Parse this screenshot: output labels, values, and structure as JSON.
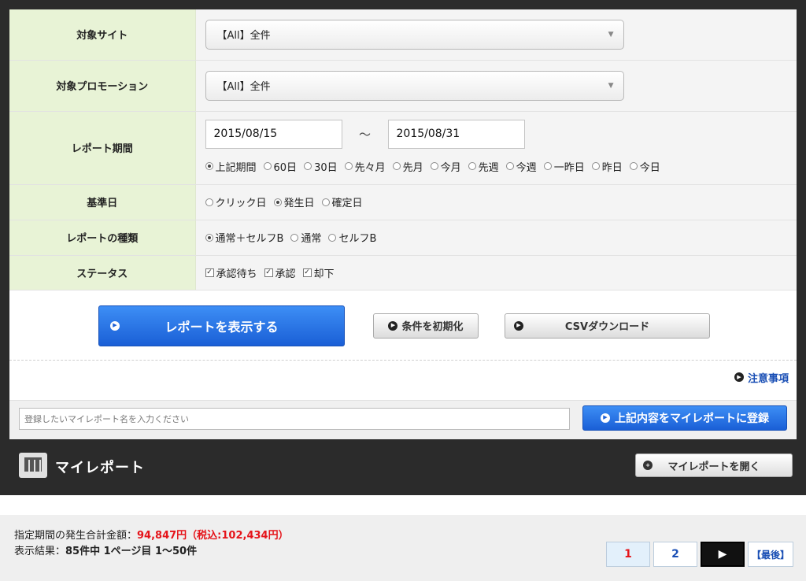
{
  "form": {
    "site": {
      "label": "対象サイト",
      "value": "【All】全件"
    },
    "promotion": {
      "label": "対象プロモーション",
      "value": "【All】全件"
    },
    "period": {
      "label": "レポート期間",
      "start": "2015/08/15",
      "separator": "〜",
      "end": "2015/08/31",
      "options": [
        "上記期間",
        "60日",
        "30日",
        "先々月",
        "先月",
        "今月",
        "先週",
        "今週",
        "一昨日",
        "昨日",
        "今日"
      ],
      "selected": "上記期間"
    },
    "base_date": {
      "label": "基準日",
      "options": [
        "クリック日",
        "発生日",
        "確定日"
      ],
      "selected": "発生日"
    },
    "report_type": {
      "label": "レポートの種類",
      "options": [
        "通常＋セルフB",
        "通常",
        "セルフB"
      ],
      "selected": "通常＋セルフB"
    },
    "status": {
      "label": "ステータス",
      "options": [
        "承認待ち",
        "承認",
        "却下"
      ],
      "checked": [
        "承認待ち",
        "承認",
        "却下"
      ]
    }
  },
  "buttons": {
    "show_report": "レポートを表示する",
    "reset": "条件を初期化",
    "csv": "CSVダウンロード",
    "notice": "注意事項",
    "save_myreport": "上記内容をマイレポートに登録",
    "open_myreport": "マイレポートを開く"
  },
  "myreport": {
    "name_placeholder": "登録したいマイレポート名を入力ください",
    "title": "マイレポート"
  },
  "summary": {
    "total_label": "指定期間の発生合計金額：",
    "total_value": "94,847円（税込:102,434円）",
    "result_label": "表示結果：",
    "result_value": "85件中 1ページ目 1〜50件"
  },
  "pagination": {
    "pages": [
      "1",
      "2"
    ],
    "current": "1",
    "next": "▶",
    "last": "【最後】"
  },
  "colors": {
    "label_bg": "#e8f3d6",
    "primary_blue": "#1a5fd6",
    "link_blue": "#1a4fb5",
    "accent_red": "#e5141a",
    "dark_frame": "#2b2b2b"
  }
}
